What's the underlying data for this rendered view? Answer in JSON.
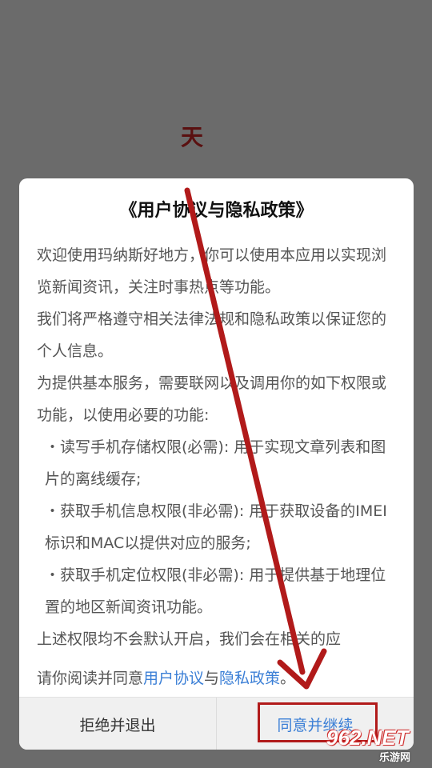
{
  "splash": {
    "logo_char": "天"
  },
  "dialog": {
    "title": "《用户协议与隐私政策》",
    "paragraphs": [
      "欢迎使用玛纳斯好地方，你可以使用本应用以实现浏览新闻资讯，关注时事热点等功能。",
      "我们将严格遵守相关法律法规和隐私政策以保证您的个人信息。",
      "为提供基本服务，需要联网以及调用你的如下权限或功能，以使用必要的功能:",
      "・读写手机存储权限(必需): 用于实现文章列表和图片的离线缓存;",
      "・获取手机信息权限(非必需): 用于获取设备的IMEI标识和MAC以提供对应的服务;",
      "・获取手机定位权限(非必需): 用于提供基于地理位置的地区新闻资讯功能。",
      "上述权限均不会默认开启，我们会在相关的应"
    ],
    "agree_prefix": "请你阅读并同意",
    "user_agreement_link": "用户协议",
    "agree_joiner": "与",
    "privacy_policy_link": "隐私政策",
    "agree_suffix": "。"
  },
  "footer": {
    "reject_label": "拒绝并退出",
    "agree_label": "同意并继续"
  },
  "watermark": {
    "main": "962.NET",
    "sub": "乐游网"
  },
  "colors": {
    "overlay": "#6b6b6b",
    "link": "#3b7fd6",
    "annotation": "#b11a1a"
  }
}
